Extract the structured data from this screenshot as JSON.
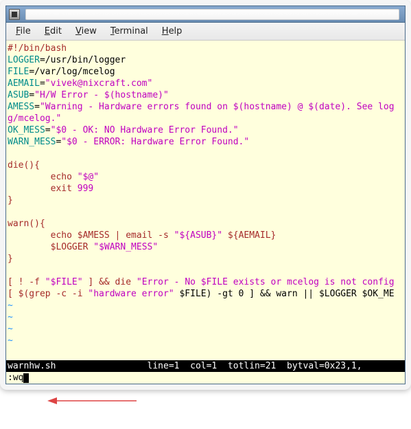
{
  "menu": {
    "file": {
      "letter": "F",
      "rest": "ile"
    },
    "edit": {
      "letter": "E",
      "rest": "dit"
    },
    "view": {
      "letter": "V",
      "rest": "iew"
    },
    "term": {
      "letter": "T",
      "rest": "erminal"
    },
    "help": {
      "letter": "H",
      "rest": "elp"
    }
  },
  "code": {
    "shebang": "#!/bin/bash",
    "logger_k": "LOGGER",
    "logger_v": "=/usr/bin/logger",
    "file_k": "FILE",
    "file_v": "=/var/log/mcelog",
    "aemail_k": "AEMAIL",
    "aemail_eq": "=",
    "aemail_v": "\"vivek@nixcraft.com\"",
    "asub_k": "ASUB",
    "asub_eq": "=",
    "asub_v": "\"H/W Error - $(hostname)\"",
    "amess_k": "AMESS",
    "amess_eq": "=",
    "amess_v": "\"Warning - Hardware errors found on $(hostname) @ $(date). See log",
    "amess_v2": "g/mcelog.\"",
    "ok_k": "OK_MESS",
    "ok_eq": "=",
    "ok_v": "\"$0 - OK: NO Hardware Error Found.\"",
    "warn_k": "WARN_MESS",
    "warn_eq": "=",
    "warn_v": "\"$0 - ERROR: Hardware Error Found.\"",
    "die_open": "die(){",
    "pad8": "        ",
    "echo": "echo ",
    "echo_arg": "\"$@\"",
    "exit": "exit ",
    "exit_code": "999",
    "warn_open": "warn(){",
    "warn_echo": "echo $AMESS | email -s ",
    "warn_sub": "\"${ASUB}\"",
    "warn_tail": " ${AEMAIL}",
    "warn_log1": "$LOGGER ",
    "warn_log1s": "\"$WARN_MESS\"",
    "brace_close": "}",
    "bl1a": "[ ! -f ",
    "bl1b": "\"$FILE\"",
    "bl1c": " ] && die ",
    "bl1d": "\"Error - No $FILE exists or mcelog is not config",
    "bl2a": "[ $(grep -c -i ",
    "bl2b": "\"hardware error\"",
    "bl2c": " $FILE) -gt 0 ] && warn || $LOGGER $OK_ME",
    "tilde": "~"
  },
  "status": {
    "filename": "warnhw.sh",
    "spacer": "                 ",
    "info": "line=1  col=1  totlin=21  bytval=0x23,1,"
  },
  "cmd": {
    "text": ":wq"
  }
}
